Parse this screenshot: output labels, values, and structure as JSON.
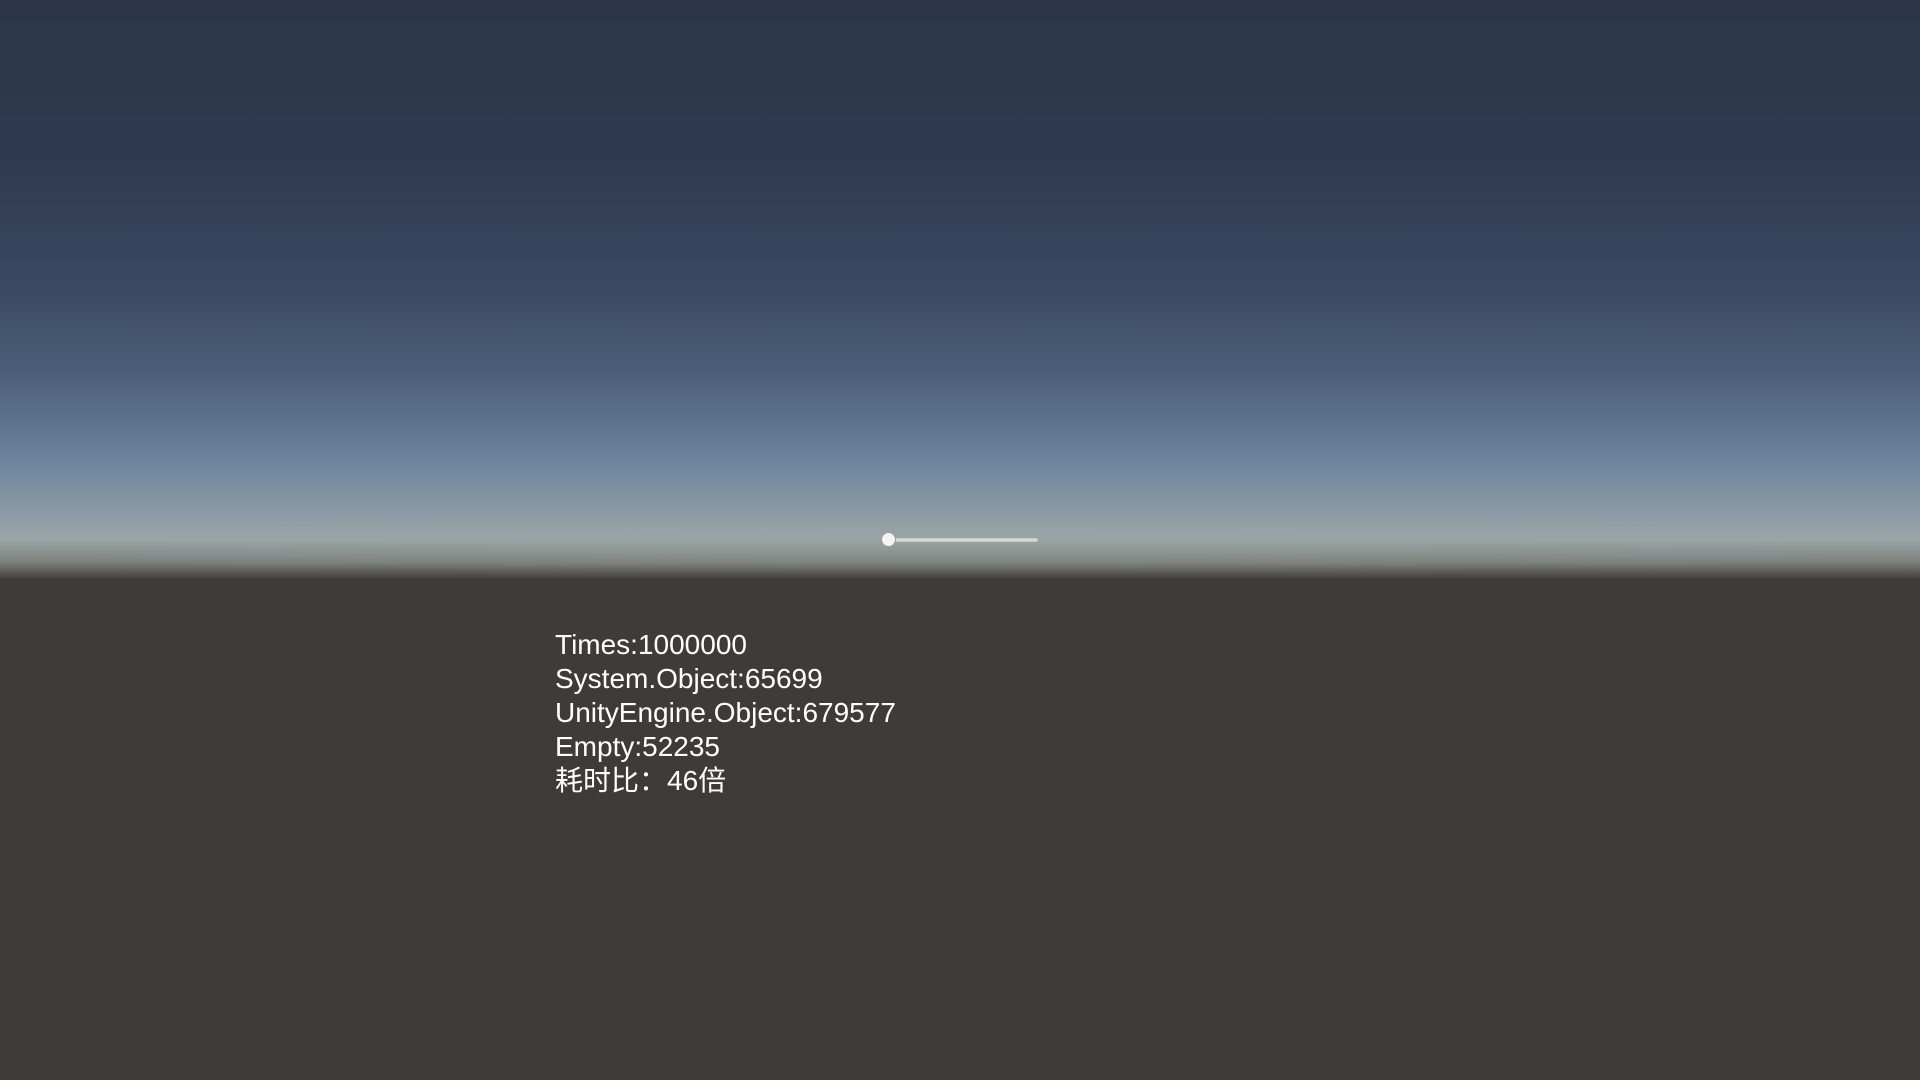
{
  "slider": {
    "value": 0.0
  },
  "stats": {
    "times": "Times:1000000",
    "system_object": "System.Object:65699",
    "unity_object": "UnityEngine.Object:679577",
    "empty": "Empty:52235",
    "ratio": "耗时比：46倍"
  }
}
